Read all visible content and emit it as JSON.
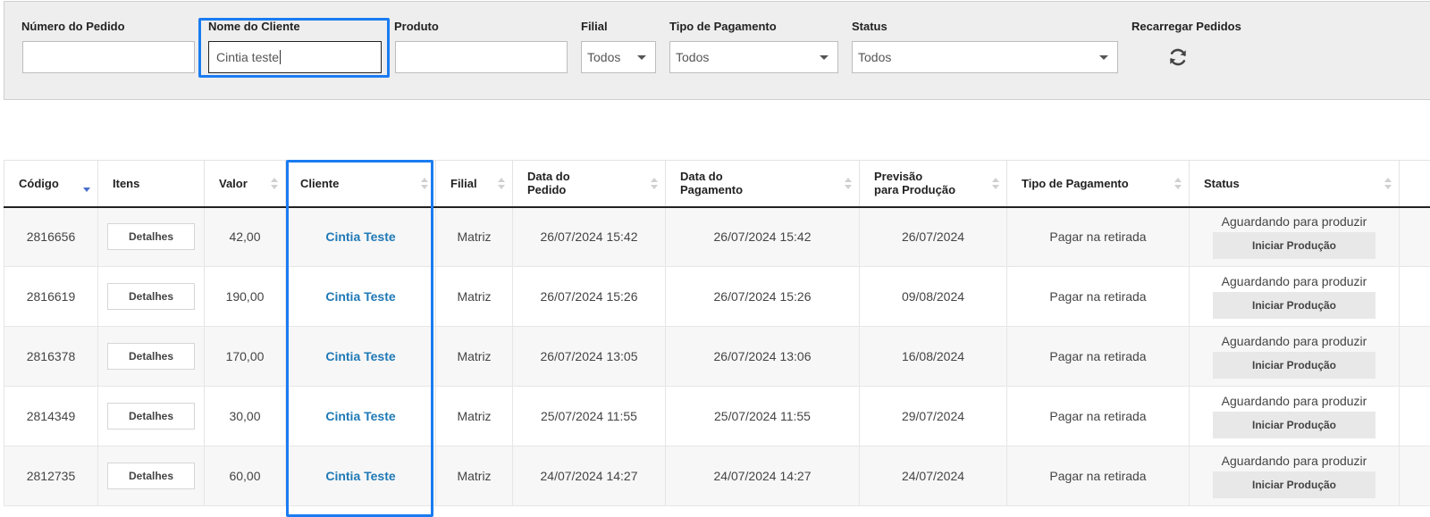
{
  "filters": {
    "order_number": {
      "label": "Número do Pedido",
      "value": ""
    },
    "client_name": {
      "label": "Nome do Cliente",
      "value": "Cintia teste"
    },
    "product": {
      "label": "Produto",
      "value": ""
    },
    "branch": {
      "label": "Filial",
      "selected": "Todos"
    },
    "payment_type": {
      "label": "Tipo de Pagamento",
      "selected": "Todos"
    },
    "status": {
      "label": "Status",
      "selected": "Todos"
    },
    "reload": {
      "label": "Recarregar Pedidos",
      "icon": "refresh-icon"
    }
  },
  "table": {
    "columns": {
      "code": "Código",
      "items": "Itens",
      "value": "Valor",
      "client": "Cliente",
      "branch": "Filial",
      "order_date_1": "Data do",
      "order_date_2": "Pedido",
      "payment_date_1": "Data do",
      "payment_date_2": "Pagamento",
      "forecast_1": "Previsão",
      "forecast_2": "para Produção",
      "payment_type": "Tipo de Pagamento",
      "status": "Status"
    },
    "sorted_column": "Código",
    "sort_direction": "desc",
    "highlight_color": "#1a7cf2",
    "link_color": "#1f79b6",
    "rows": [
      {
        "code": "2816656",
        "items": "Detalhes",
        "value": "42,00",
        "client": "Cintia Teste",
        "branch": "Matriz",
        "order_date": "26/07/2024 15:42",
        "payment_date": "26/07/2024 15:42",
        "forecast": "26/07/2024",
        "payment_type": "Pagar na retirada",
        "status": "Aguardando para produzir",
        "action": "Iniciar Produção"
      },
      {
        "code": "2816619",
        "items": "Detalhes",
        "value": "190,00",
        "client": "Cintia Teste",
        "branch": "Matriz",
        "order_date": "26/07/2024 15:26",
        "payment_date": "26/07/2024 15:26",
        "forecast": "09/08/2024",
        "payment_type": "Pagar na retirada",
        "status": "Aguardando para produzir",
        "action": "Iniciar Produção"
      },
      {
        "code": "2816378",
        "items": "Detalhes",
        "value": "170,00",
        "client": "Cintia Teste",
        "branch": "Matriz",
        "order_date": "26/07/2024 13:05",
        "payment_date": "26/07/2024 13:06",
        "forecast": "16/08/2024",
        "payment_type": "Pagar na retirada",
        "status": "Aguardando para produzir",
        "action": "Iniciar Produção"
      },
      {
        "code": "2814349",
        "items": "Detalhes",
        "value": "30,00",
        "client": "Cintia Teste",
        "branch": "Matriz",
        "order_date": "25/07/2024 11:55",
        "payment_date": "25/07/2024 11:55",
        "forecast": "29/07/2024",
        "payment_type": "Pagar na retirada",
        "status": "Aguardando para produzir",
        "action": "Iniciar Produção"
      },
      {
        "code": "2812735",
        "items": "Detalhes",
        "value": "60,00",
        "client": "Cintia Teste",
        "branch": "Matriz",
        "order_date": "24/07/2024 14:27",
        "payment_date": "24/07/2024 14:27",
        "forecast": "24/07/2024",
        "payment_type": "Pagar na retirada",
        "status": "Aguardando para produzir",
        "action": "Iniciar Produção"
      }
    ]
  }
}
